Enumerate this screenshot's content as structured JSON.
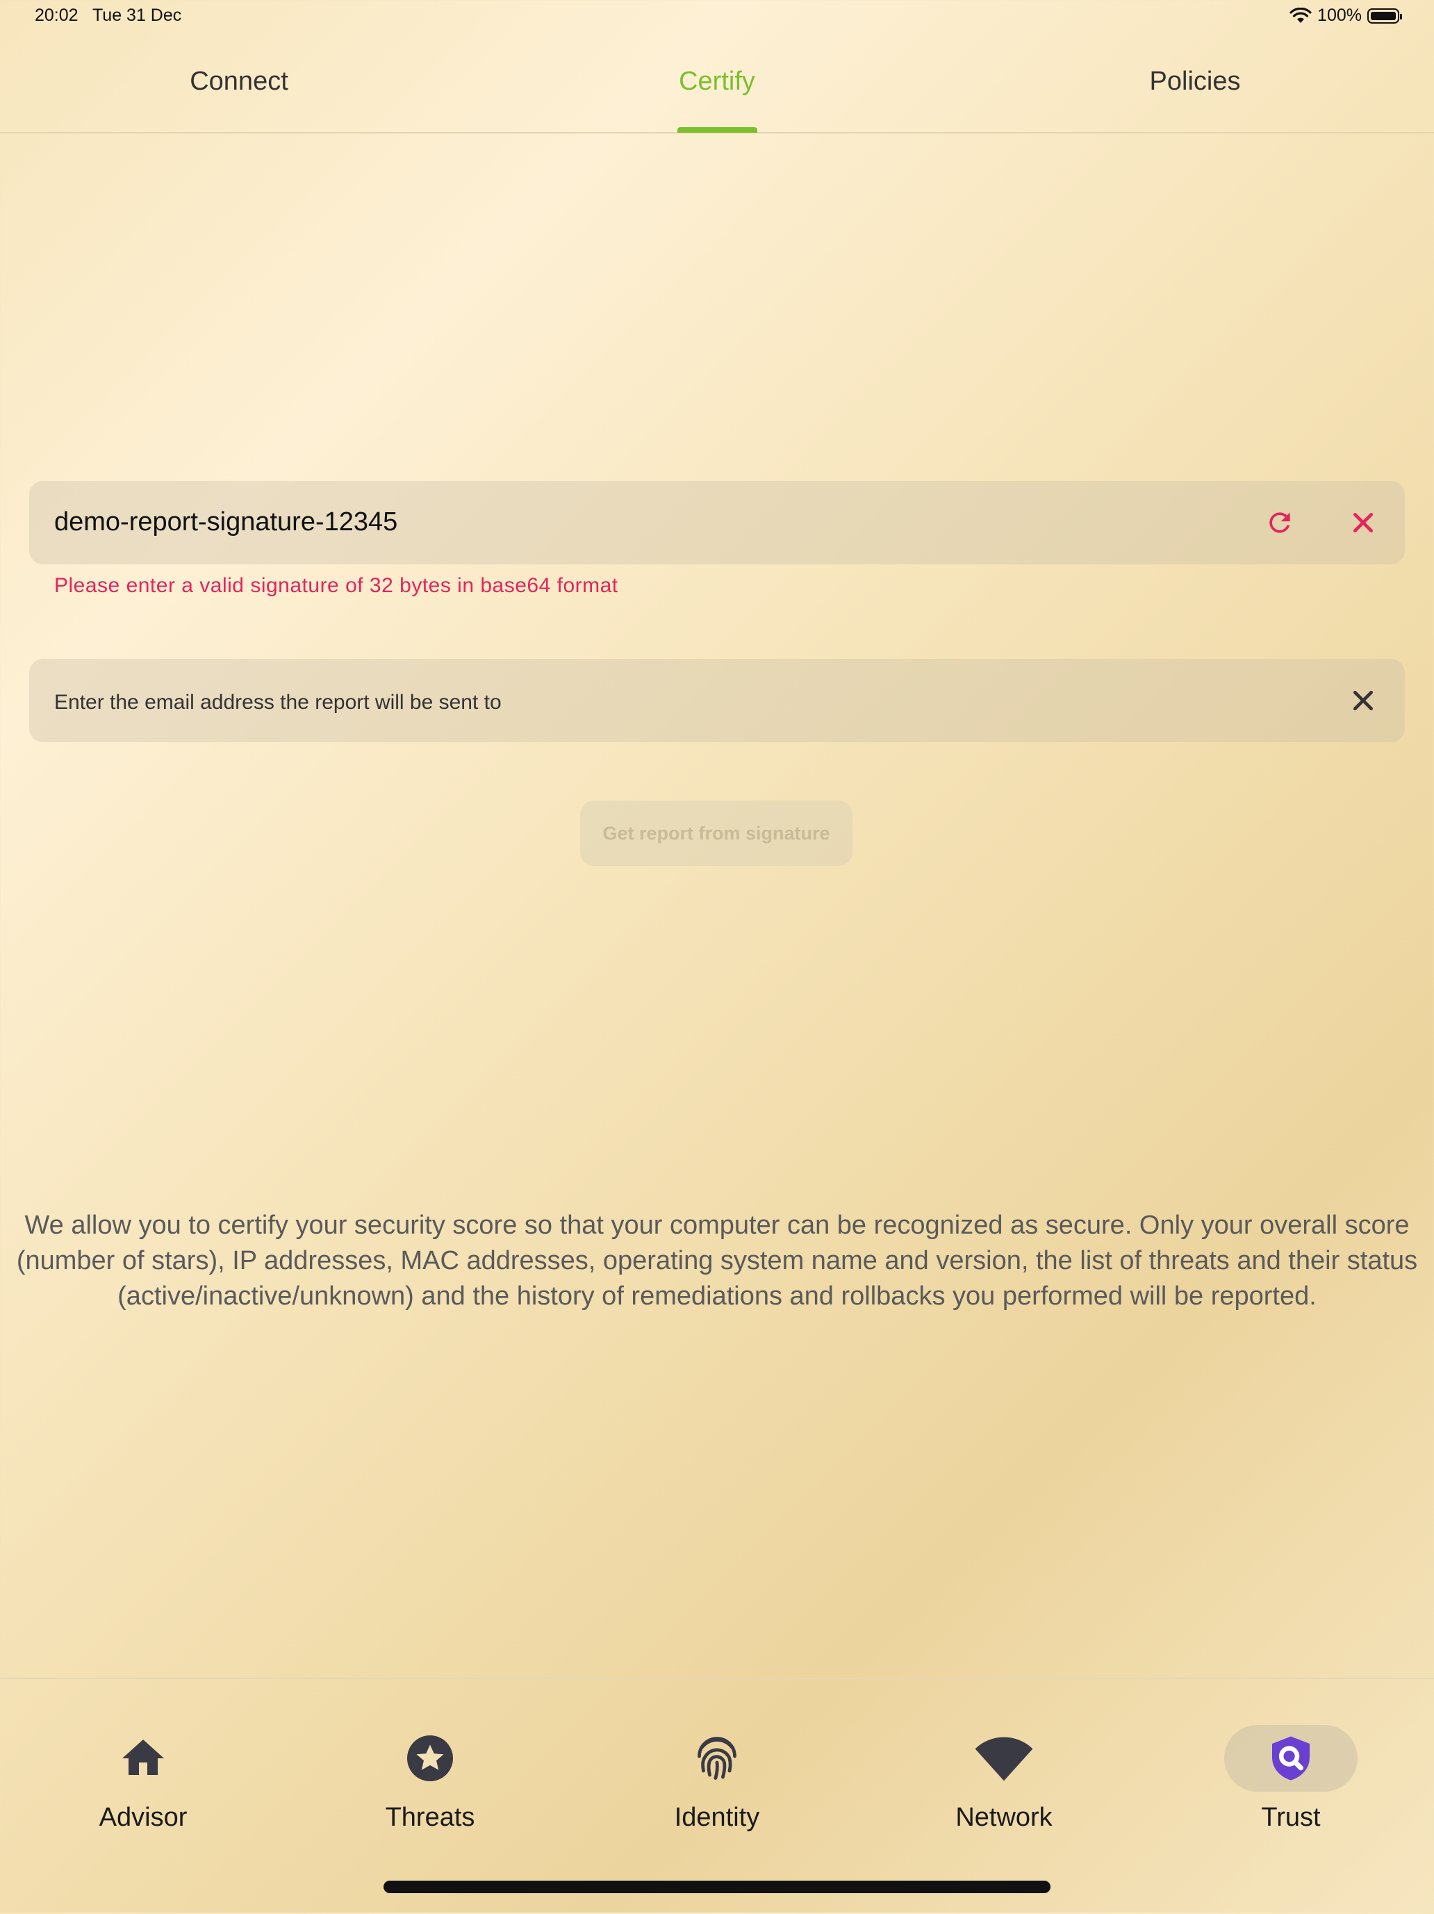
{
  "status_bar": {
    "time": "20:02",
    "date": "Tue 31 Dec",
    "battery": "100%"
  },
  "tabs": [
    {
      "label": "Connect",
      "active": false
    },
    {
      "label": "Certify",
      "active": true
    },
    {
      "label": "Policies",
      "active": false
    }
  ],
  "signature_field": {
    "value": "demo-report-signature-12345",
    "error": "Please enter a valid signature of 32 bytes in base64 format"
  },
  "email_field": {
    "placeholder": "Enter the email address the report will be sent to"
  },
  "get_report_button": {
    "label": "Get report from signature",
    "disabled": true
  },
  "info_text": "We allow you to certify your security score so that your computer can be recognized as secure. Only your overall score (number of stars), IP addresses, MAC addresses, operating system name and version, the list of threats and their status (active/inactive/unknown) and the history of remediations and rollbacks you performed will be reported.",
  "bottom_nav": [
    {
      "label": "Advisor",
      "icon": "home-icon",
      "active": false
    },
    {
      "label": "Threats",
      "icon": "star-circle-icon",
      "active": false
    },
    {
      "label": "Identity",
      "icon": "fingerprint-icon",
      "active": false
    },
    {
      "label": "Network",
      "icon": "wifi-icon",
      "active": false
    },
    {
      "label": "Trust",
      "icon": "shield-search-icon",
      "active": true
    }
  ],
  "colors": {
    "accent_green": "#7cbf2e",
    "error_red": "#e5245c",
    "trust_purple": "#6a3fd1"
  }
}
